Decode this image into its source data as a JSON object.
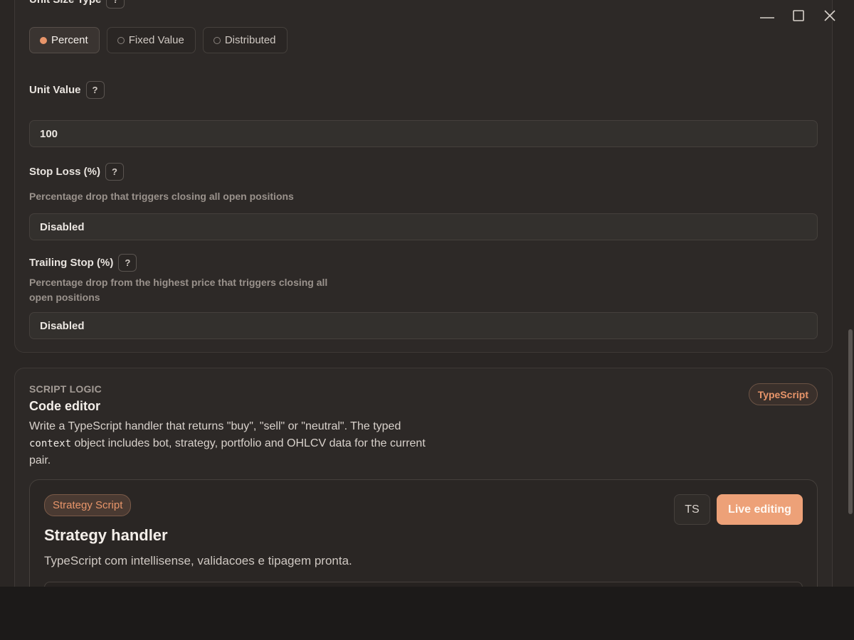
{
  "window": {
    "minimize": "minimize",
    "maximize": "maximize",
    "close": "close"
  },
  "position_sizing": {
    "unit_size_type": {
      "label": "Unit Size Type",
      "help": "?",
      "options": [
        "Percent",
        "Fixed Value",
        "Distributed"
      ],
      "selected": "Percent"
    },
    "unit_value": {
      "label": "Unit Value",
      "help": "?",
      "value": "100"
    },
    "stop_loss": {
      "label": "Stop Loss (%)",
      "help": "?",
      "description": "Percentage drop that triggers closing all open positions",
      "value": "Disabled"
    },
    "trailing_stop": {
      "label": "Trailing Stop (%)",
      "help": "?",
      "description_line1": "Percentage drop from the highest price that triggers closing all",
      "description_line2": "open positions",
      "value": "Disabled"
    }
  },
  "script_logic": {
    "eyebrow": "SCRIPT LOGIC",
    "title": "Code editor",
    "desc_part1": "Write a TypeScript handler that returns \"buy\", \"sell\" or \"neutral\". The typed",
    "desc_code": "context",
    "desc_part2": " object includes bot, strategy, portfolio and OHLCV data for the current pair.",
    "badge": "TypeScript",
    "editor": {
      "pill": "Strategy Script",
      "title": "Strategy handler",
      "subtitle": "TypeScript com intellisense, validacoes e tipagem pronta.",
      "ts_button": "TS",
      "live_button": "Live editing"
    }
  },
  "colors": {
    "accent": "#e8956a",
    "background": "#2a2624",
    "card": "#2d2927"
  }
}
